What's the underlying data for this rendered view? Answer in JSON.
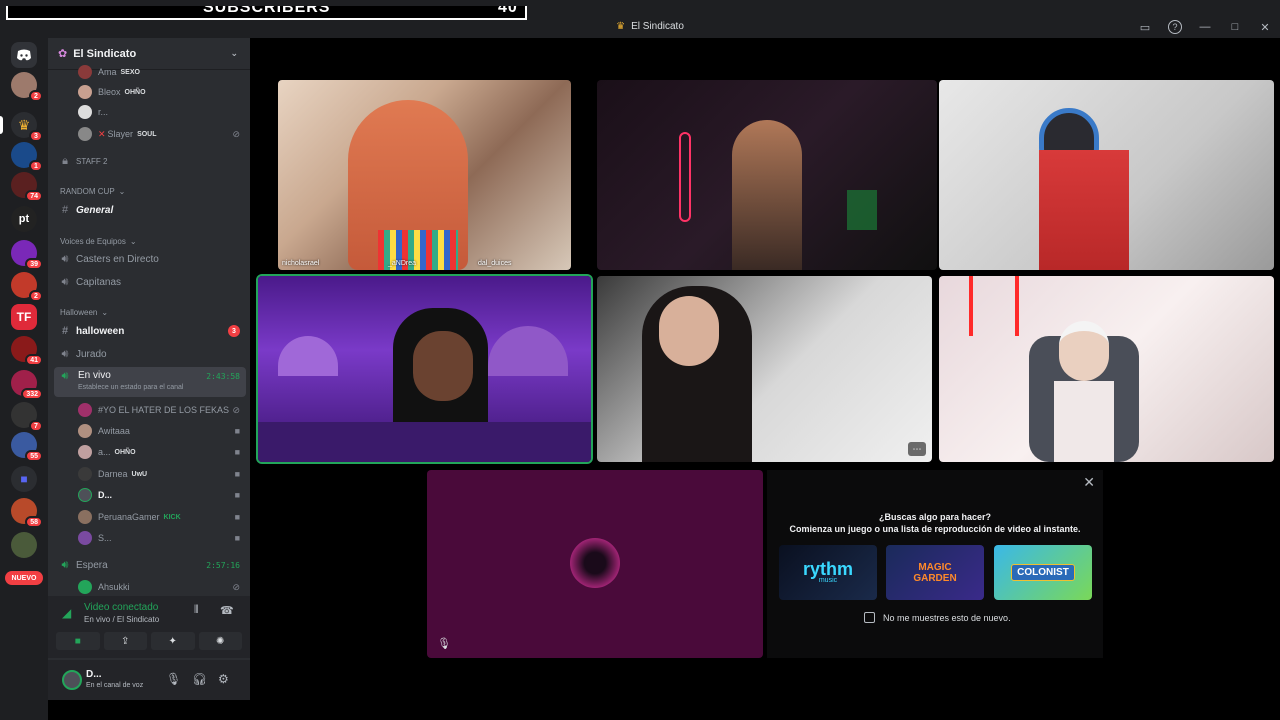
{
  "window": {
    "title": "El Sindicato",
    "overlay_text": "SUBSCRIBERS",
    "overlay_value": "40"
  },
  "server": {
    "name": "El Sindicato"
  },
  "rail": {
    "new_label": "NUEVO",
    "badges": [
      "2",
      "3",
      "1",
      "74",
      "2",
      "39",
      "2",
      "41",
      "332",
      "7",
      "55",
      "58"
    ]
  },
  "sidebar": {
    "top_users": [
      {
        "name": "Ama",
        "tag": "SEXO"
      },
      {
        "name": "Bleox",
        "tag": "OHÑO"
      },
      {
        "name": "r...",
        "tag": ""
      },
      {
        "name": "Slayer",
        "tag": "SOUL"
      }
    ],
    "staff": "STAFF 2",
    "cat_random": "RANDOM CUP",
    "general": "General",
    "cat_voices": "Voices de Equipos",
    "casters": "Casters en Directo",
    "capitanas": "Capitanas",
    "cat_halloween": "Halloween",
    "halloween_channel": "halloween",
    "halloween_badge": "3",
    "jurado": "Jurado",
    "envivo": "En vivo",
    "envivo_timer": "2:43:58",
    "envivo_status": "Establece un estado para el canal",
    "voice_users": [
      {
        "name": "#YO EL HATER DE LOS FEKAS",
        "tag": ""
      },
      {
        "name": "Awitaaa",
        "tag": ""
      },
      {
        "name": "a...",
        "tag": "OHÑO"
      },
      {
        "name": "Darnea",
        "tag": "UwU"
      },
      {
        "name": "D...",
        "tag": ""
      },
      {
        "name": "PeruanaGamer",
        "tag": "KICK"
      },
      {
        "name": "S...",
        "tag": ""
      }
    ],
    "espera": "Espera",
    "espera_timer": "2:57:16",
    "espera_user": "Ahsukki"
  },
  "voice_panel": {
    "title": "Video conectado",
    "subtitle": "En vivo / El Sindicato"
  },
  "user_panel": {
    "name": "D...",
    "status": "En el canal de voz"
  },
  "tiles": {
    "name1": "nicholasrael",
    "name2": "_aNDrea",
    "name3": "dal_duices"
  },
  "activity": {
    "line1": "¿Buscas algo para hacer?",
    "line2": "Comienza un juego o una lista de reproducción de video al instante.",
    "card1": "rythm",
    "card1_sub": "music",
    "card2": "MAGIC GARDEN",
    "card3": "COLONIST",
    "checkbox": "No me muestres esto de nuevo."
  },
  "colors": {
    "accent": "#23a55a",
    "danger": "#f23f43",
    "sidebar": "#2b2d31",
    "rail": "#1e1f22"
  }
}
